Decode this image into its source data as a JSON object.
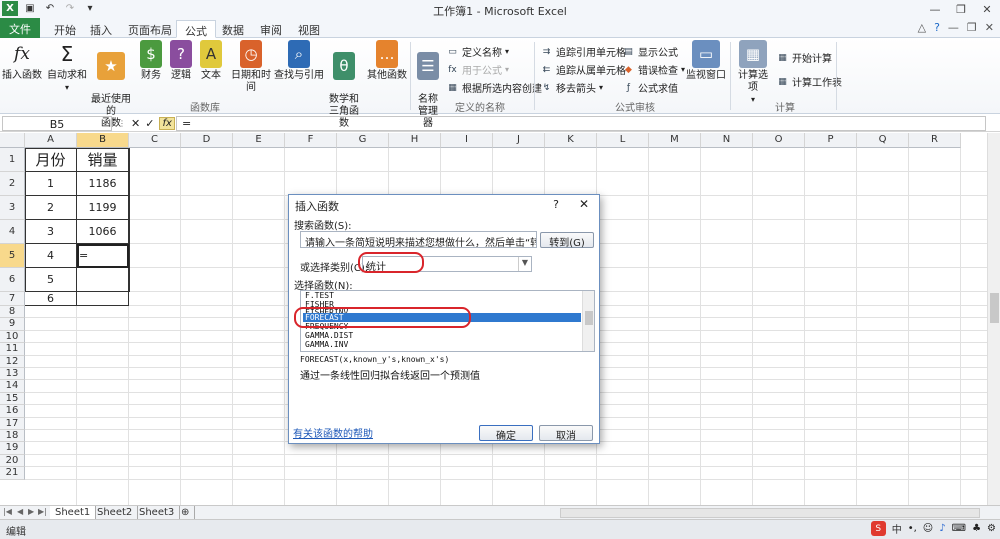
{
  "window": {
    "title": "工作簿1 - Microsoft Excel",
    "controls": [
      "minimize-icon",
      "restore-icon",
      "close-icon"
    ]
  },
  "quick_access": [
    "excel-logo-icon",
    "save-icon",
    "undo-icon",
    "redo-icon",
    "customize-icon"
  ],
  "tabs": {
    "file": "文件",
    "items": [
      "开始",
      "插入",
      "页面布局",
      "公式",
      "数据",
      "审阅",
      "视图"
    ],
    "active": "公式"
  },
  "ribbon": {
    "function_library": {
      "label": "函数库",
      "buttons": [
        {
          "label": "插入函数",
          "icon": "fx"
        },
        {
          "label": "自动求和",
          "icon": "Σ"
        },
        {
          "label": "最近使用的\n函数",
          "icon": "★"
        },
        {
          "label": "财务",
          "icon": "$"
        },
        {
          "label": "逻辑",
          "icon": "?"
        },
        {
          "label": "文本",
          "icon": "A"
        },
        {
          "label": "日期和时间",
          "icon": "◷"
        },
        {
          "label": "查找与引用",
          "icon": "⌕"
        },
        {
          "label": "数学和\n三角函数",
          "icon": "θ"
        },
        {
          "label": "其他函数",
          "icon": "…"
        }
      ]
    },
    "defined_names": {
      "label": "定义的名称",
      "manager": "名称\n管理器",
      "define": "定义名称",
      "use_in_formula": "用于公式",
      "create_from_selection": "根据所选内容创建"
    },
    "formula_auditing": {
      "label": "公式审核",
      "trace_precedents": "追踪引用单元格",
      "trace_dependents": "追踪从属单元格",
      "remove_arrows": "移去箭头",
      "show_formulas": "显示公式",
      "error_checking": "错误检查",
      "evaluate_formula": "公式求值",
      "watch_window": "监视窗口"
    },
    "calculation": {
      "label": "计算",
      "options": "计算选项",
      "calc_now": "开始计算",
      "calc_sheet": "计算工作表"
    }
  },
  "formula_bar": {
    "name_box": "B5",
    "content": "="
  },
  "columns": [
    "A",
    "B",
    "C",
    "D",
    "E",
    "F",
    "G",
    "H",
    "I",
    "J",
    "K",
    "L",
    "M",
    "N",
    "O",
    "P",
    "Q",
    "R"
  ],
  "rows": [
    "1",
    "2",
    "3",
    "4",
    "5",
    "6",
    "7",
    "8",
    "9",
    "10",
    "11",
    "12",
    "13",
    "14",
    "15",
    "16",
    "17",
    "18",
    "19",
    "20",
    "21"
  ],
  "table": {
    "header": [
      "月份",
      "销量"
    ],
    "rows": [
      [
        "1",
        "1186"
      ],
      [
        "2",
        "1199"
      ],
      [
        "3",
        "1066"
      ],
      [
        "4",
        "="
      ],
      [
        "5",
        ""
      ],
      [
        "6",
        ""
      ]
    ]
  },
  "sheets": [
    "Sheet1",
    "Sheet2",
    "Sheet3"
  ],
  "status": "编辑",
  "dialog": {
    "title": "插入函数",
    "help": "?",
    "search_label": "搜索函数(S):",
    "search_text": "请输入一条简短说明来描述您想做什么，然后单击“转到”",
    "go_button": "转到(G)",
    "category_label": "或选择类别(C):",
    "category_value": "统计",
    "list_label": "选择函数(N):",
    "functions": [
      "F.TEST",
      "FISHER",
      "FISHERINV",
      "FORECAST",
      "FREQUENCY",
      "GAMMA.DIST",
      "GAMMA.INV"
    ],
    "selected_function": "FORECAST",
    "syntax": "FORECAST(x,known_y's,known_x's)",
    "description": "通过一条线性回归拟合线返回一个预测值",
    "help_link": "有关该函数的帮助",
    "ok": "确定",
    "cancel": "取消"
  },
  "colors": {
    "file_tab": "#2b8b45",
    "selection_header": "#f8d98c",
    "highlight": "#d9252b",
    "list_selection": "#2f79cf"
  }
}
